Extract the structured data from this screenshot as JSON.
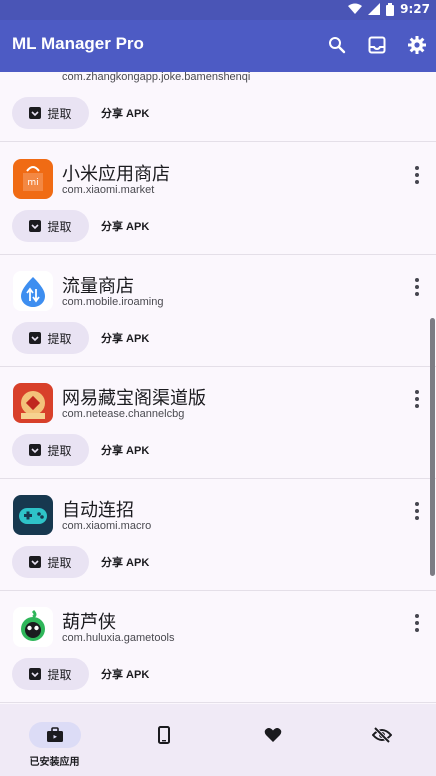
{
  "status": {
    "time": "9:27"
  },
  "app": {
    "title": "ML Manager Pro"
  },
  "items": [
    {
      "name": "",
      "pkg": "com.zhangkongapp.joke.bamenshenqi",
      "extract": "提取",
      "share": "分享 APK"
    },
    {
      "name": "小米应用商店",
      "pkg": "com.xiaomi.market",
      "extract": "提取",
      "share": "分享 APK"
    },
    {
      "name": "流量商店",
      "pkg": "com.mobile.iroaming",
      "extract": "提取",
      "share": "分享 APK"
    },
    {
      "name": "网易藏宝阁渠道版",
      "pkg": "com.netease.channelcbg",
      "extract": "提取",
      "share": "分享 APK"
    },
    {
      "name": "自动连招",
      "pkg": "com.xiaomi.macro",
      "extract": "提取",
      "share": "分享 APK"
    },
    {
      "name": "葫芦侠",
      "pkg": "com.huluxia.gametools",
      "extract": "提取",
      "share": "分享 APK"
    }
  ],
  "nav": {
    "installed_label": "已安装应用"
  },
  "colors": {
    "appbar": "#4d5bc4",
    "chip": "#e9e3f3",
    "active_pill": "#dcdcf6"
  }
}
